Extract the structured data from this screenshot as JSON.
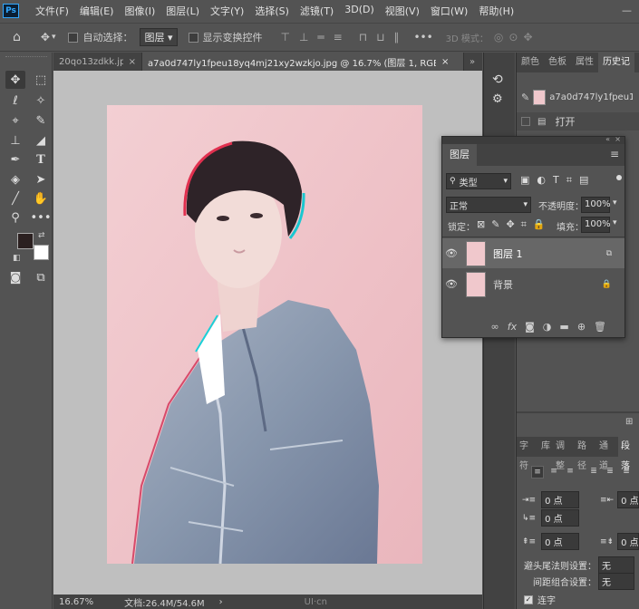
{
  "app": {
    "logo": "Ps"
  },
  "menu": [
    "文件(F)",
    "编辑(E)",
    "图像(I)",
    "图层(L)",
    "文字(Y)",
    "选择(S)",
    "滤镜(T)",
    "3D(D)",
    "视图(V)",
    "窗口(W)",
    "帮助(H)"
  ],
  "window_controls": "—",
  "options": {
    "auto_select_label": "自动选择：",
    "auto_select_value": "图层",
    "show_transform_label": "显示变换控件",
    "more": "•••",
    "mode3d_label": "3D 模式："
  },
  "tabs": [
    {
      "label": "20qo13zdkk.jpg",
      "close": "×"
    },
    {
      "label": "a7a0d747ly1fpeu18yq4mj21xy2wzkjo.jpg @ 16.7% (图层 1, RGB/8#) *",
      "close": "×"
    }
  ],
  "tab_overflow": "»",
  "status": {
    "zoom": "16.67%",
    "doc": "文档:26.4M/54.6M",
    "arrow": "›"
  },
  "watermark": "UI·cn",
  "right_panel": {
    "tabs": [
      "颜色",
      "色板",
      "属性",
      "历史记"
    ],
    "history_snapshot": "a7a0d747ly1fpeu18yq4m",
    "history_item": "打开",
    "lower_tabs": [
      "字符",
      "库",
      "调整",
      "路径",
      "通道",
      "段落"
    ],
    "indent_left": "0 点",
    "indent_right": "0 点",
    "first_indent": "0 点",
    "space_before": "0 点",
    "space_after": "0 点",
    "kinsoku_label": "避头尾法则设置：",
    "kinsoku_value": "无",
    "mojikumi_label": "间距组合设置：",
    "mojikumi_value": "无",
    "hyphen_label": "连字"
  },
  "layers": {
    "title": "图层",
    "filter": "类型",
    "blend": "正常",
    "opacity_label": "不透明度：",
    "opacity": "100%",
    "lock_label": "锁定：",
    "fill_label": "填充：",
    "fill": "100%",
    "items": [
      {
        "name": "图层 1",
        "selected": true
      },
      {
        "name": "背景",
        "selected": false
      }
    ]
  }
}
